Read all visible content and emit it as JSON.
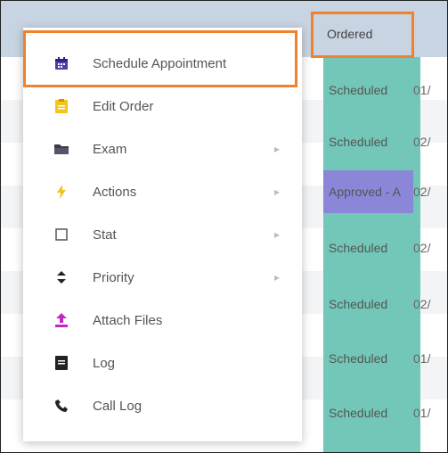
{
  "table": {
    "status_header": "Ordered",
    "rows": [
      {
        "status": "Scheduled",
        "date": "01/"
      },
      {
        "status": "Scheduled",
        "date": "02/"
      },
      {
        "status": "Approved - A",
        "date": "02/"
      },
      {
        "status": "Scheduled",
        "date": "02/"
      },
      {
        "status": "Scheduled",
        "date": "02/"
      },
      {
        "status": "Scheduled",
        "date": "01/"
      },
      {
        "status": "Scheduled",
        "date": "01/"
      }
    ]
  },
  "menu": {
    "items": [
      {
        "label": "Schedule Appointment",
        "icon": "calendar-icon",
        "submenu": false
      },
      {
        "label": "Edit Order",
        "icon": "clipboard-icon",
        "submenu": false
      },
      {
        "label": "Exam",
        "icon": "folder-icon",
        "submenu": true
      },
      {
        "label": "Actions",
        "icon": "bolt-icon",
        "submenu": true
      },
      {
        "label": "Stat",
        "icon": "checkbox-icon",
        "submenu": true
      },
      {
        "label": "Priority",
        "icon": "sort-icon",
        "submenu": true
      },
      {
        "label": "Attach Files",
        "icon": "upload-icon",
        "submenu": false
      },
      {
        "label": "Log",
        "icon": "log-icon",
        "submenu": false
      },
      {
        "label": "Call Log",
        "icon": "phone-icon",
        "submenu": false
      }
    ]
  },
  "colors": {
    "accent_outline": "#f0812d",
    "scheduled": "#73c7b8",
    "approved": "#8b86d8",
    "header": "#c9d4e2"
  }
}
